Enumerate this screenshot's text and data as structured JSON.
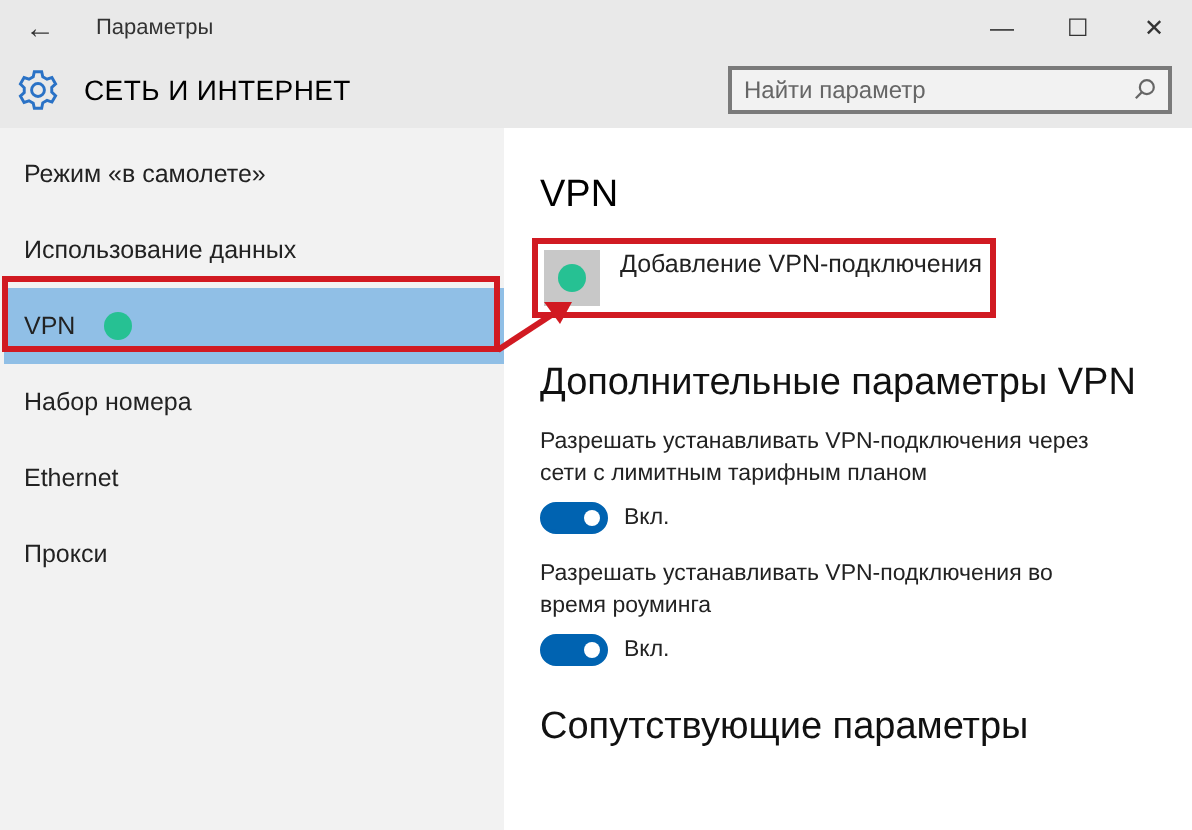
{
  "window": {
    "title": "Параметры",
    "back": "←",
    "controls": [
      "—",
      "☐",
      "✕"
    ]
  },
  "header": {
    "title": "СЕТЬ И ИНТЕРНЕТ",
    "search": {
      "placeholder": "Найти параметр"
    }
  },
  "sidebar": {
    "items": [
      {
        "label": "Режим «в самолете»",
        "selected": false
      },
      {
        "label": "Использование данных",
        "selected": false
      },
      {
        "label": "VPN",
        "selected": true
      },
      {
        "label": "Набор номера",
        "selected": false
      },
      {
        "label": "Ethernet",
        "selected": false
      },
      {
        "label": "Прокси",
        "selected": false
      }
    ]
  },
  "content": {
    "title": "VPN",
    "add_button": "Добавление VPN-подключения",
    "advanced_title": "Дополнительные параметры VPN",
    "options": [
      {
        "label": "Разрешать устанавливать VPN-подключения через сети с лимитным тарифным планом",
        "on": true,
        "state": "Вкл."
      },
      {
        "label": "Разрешать устанавливать VPN-подключения во время роуминга",
        "on": true,
        "state": "Вкл."
      }
    ],
    "related_title": "Сопутствующие параметры"
  }
}
